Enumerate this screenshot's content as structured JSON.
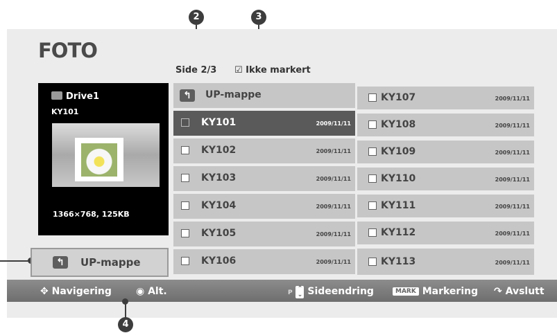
{
  "callouts": [
    "2",
    "3",
    "4"
  ],
  "title": "FOTO",
  "page_indicator": "Side 2/3",
  "mark_indicator": "☑ Ikke markert",
  "preview": {
    "drive": "Drive1",
    "file": "KY101",
    "resolution": "1366×768, 125KB"
  },
  "up_folder": "UP-mappe",
  "grid": {
    "up_folder": "UP-mappe",
    "left": [
      {
        "name": "KY101",
        "date": "2009/11/11"
      },
      {
        "name": "KY102",
        "date": "2009/11/11"
      },
      {
        "name": "KY103",
        "date": "2009/11/11"
      },
      {
        "name": "KY104",
        "date": "2009/11/11"
      },
      {
        "name": "KY105",
        "date": "2009/11/11"
      },
      {
        "name": "KY106",
        "date": "2009/11/11"
      }
    ],
    "right": [
      {
        "name": "KY107",
        "date": "2009/11/11"
      },
      {
        "name": "KY108",
        "date": "2009/11/11"
      },
      {
        "name": "KY109",
        "date": "2009/11/11"
      },
      {
        "name": "KY110",
        "date": "2009/11/11"
      },
      {
        "name": "KY111",
        "date": "2009/11/11"
      },
      {
        "name": "KY112",
        "date": "2009/11/11"
      },
      {
        "name": "KY113",
        "date": "2009/11/11"
      }
    ]
  },
  "bottom_bar": {
    "navigation": "Navigering",
    "options": "Alt.",
    "page_key": "P",
    "page_change": "Sideendring",
    "mark_key": "MARK",
    "marking": "Markering",
    "exit": "Avslutt"
  }
}
